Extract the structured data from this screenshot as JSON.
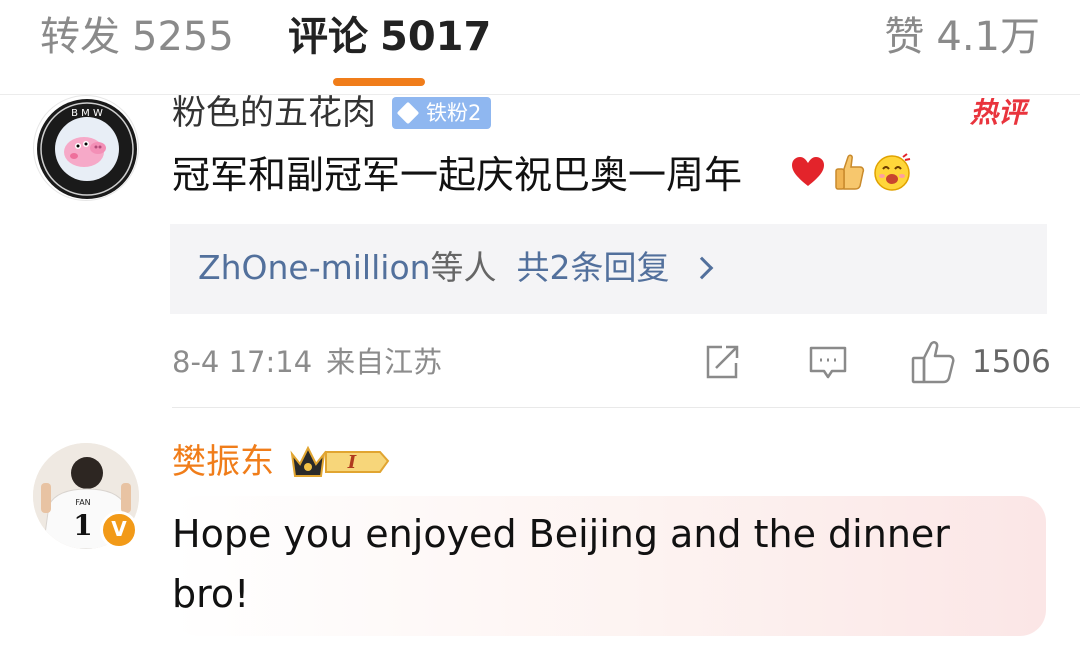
{
  "tabs": {
    "repost_label": "转发",
    "repost_count": "5255",
    "comment_label": "评论",
    "comment_count": "5017",
    "like_label": "赞",
    "like_count": "4.1万",
    "active": "comment",
    "indicator_color": "#f07d1a"
  },
  "comments": [
    {
      "avatar_text": "BMW",
      "username": "粉色的五花肉",
      "fan_badge": "铁粉2",
      "hot_tag": "热评",
      "text": "冠军和副冠军一起庆祝巴奥一周年",
      "emojis": [
        "heart-emoji",
        "thumbs-up-emoji",
        "smile-emoji"
      ],
      "replies": {
        "users": "ZhOne-million",
        "etc": "等人",
        "count_label": "共2条回复"
      },
      "date": "8-4 17:14",
      "location": "来自江苏",
      "likes": "1506"
    },
    {
      "avatar_text": "FAN 1",
      "username": "樊振东",
      "crown_level": "I",
      "verified_mark": "V",
      "text": "Hope you enjoyed Beijing and the dinner bro!"
    }
  ],
  "colors": {
    "link_blue": "#52709c",
    "orange": "#f07d1a",
    "hot_red": "#e9343d",
    "meta_gray": "#8c8c8c"
  }
}
